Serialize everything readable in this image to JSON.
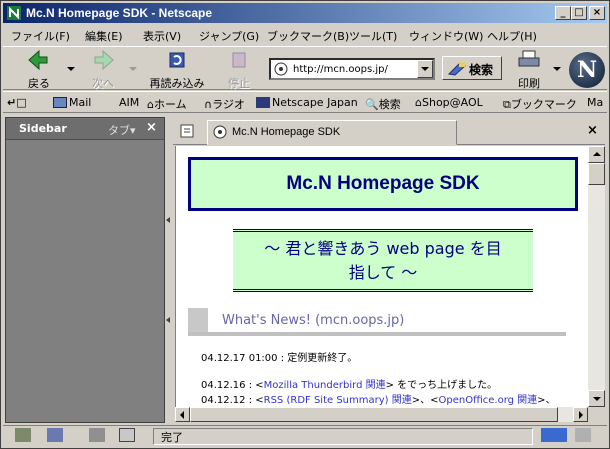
{
  "window": {
    "title": "Mc.N Homepage SDK - Netscape"
  },
  "menu": [
    "ファイル(F)",
    "編集(E)",
    "表示(V)",
    "ジャンプ(G)",
    "ブックマーク(B)",
    "ツール(T)",
    "ウィンドウ(W)",
    "ヘルプ(H)"
  ],
  "toolbar": {
    "back": "戻る",
    "forward": "次へ",
    "reload": "再読み込み",
    "stop": "停止",
    "url": "http://mcn.oops.jp/",
    "search": "検索",
    "print": "印刷",
    "throbber_letter": "N"
  },
  "personal_toolbar": [
    "Mail",
    "AIM",
    "ホーム",
    "ラジオ",
    "Netscape Japan",
    "検索",
    "Shop@AOL",
    "ブックマーク",
    "Ma"
  ],
  "sidebar": {
    "title": "Sidebar",
    "tabs_label": "タブ▾",
    "close": "×"
  },
  "tab": {
    "title": "Mc.N Homepage SDK",
    "close": "×"
  },
  "page": {
    "heading": "Mc.N Homepage SDK",
    "subtitle_line1": "〜 君と響きあう web page を目",
    "subtitle_line2": "指して 〜",
    "news_title": "What's News! (mcn.oops.jp)",
    "news": [
      {
        "date": "04.12.17 01:00",
        "pre": " : 定例更新終了。",
        "link": "",
        "post": ""
      },
      {
        "date": "04.12.16",
        "pre": " : <",
        "link": "Mozilla Thunderbird 関連",
        "post": "> をでっち上げました。"
      },
      {
        "date": "04.12.12",
        "pre": " : <",
        "link": "RSS (RDF Site Summary) 関連",
        "post": ">、<",
        "link2": "OpenOffice.org 関連",
        "post2": ">、"
      }
    ]
  },
  "status": {
    "text": "完了"
  }
}
